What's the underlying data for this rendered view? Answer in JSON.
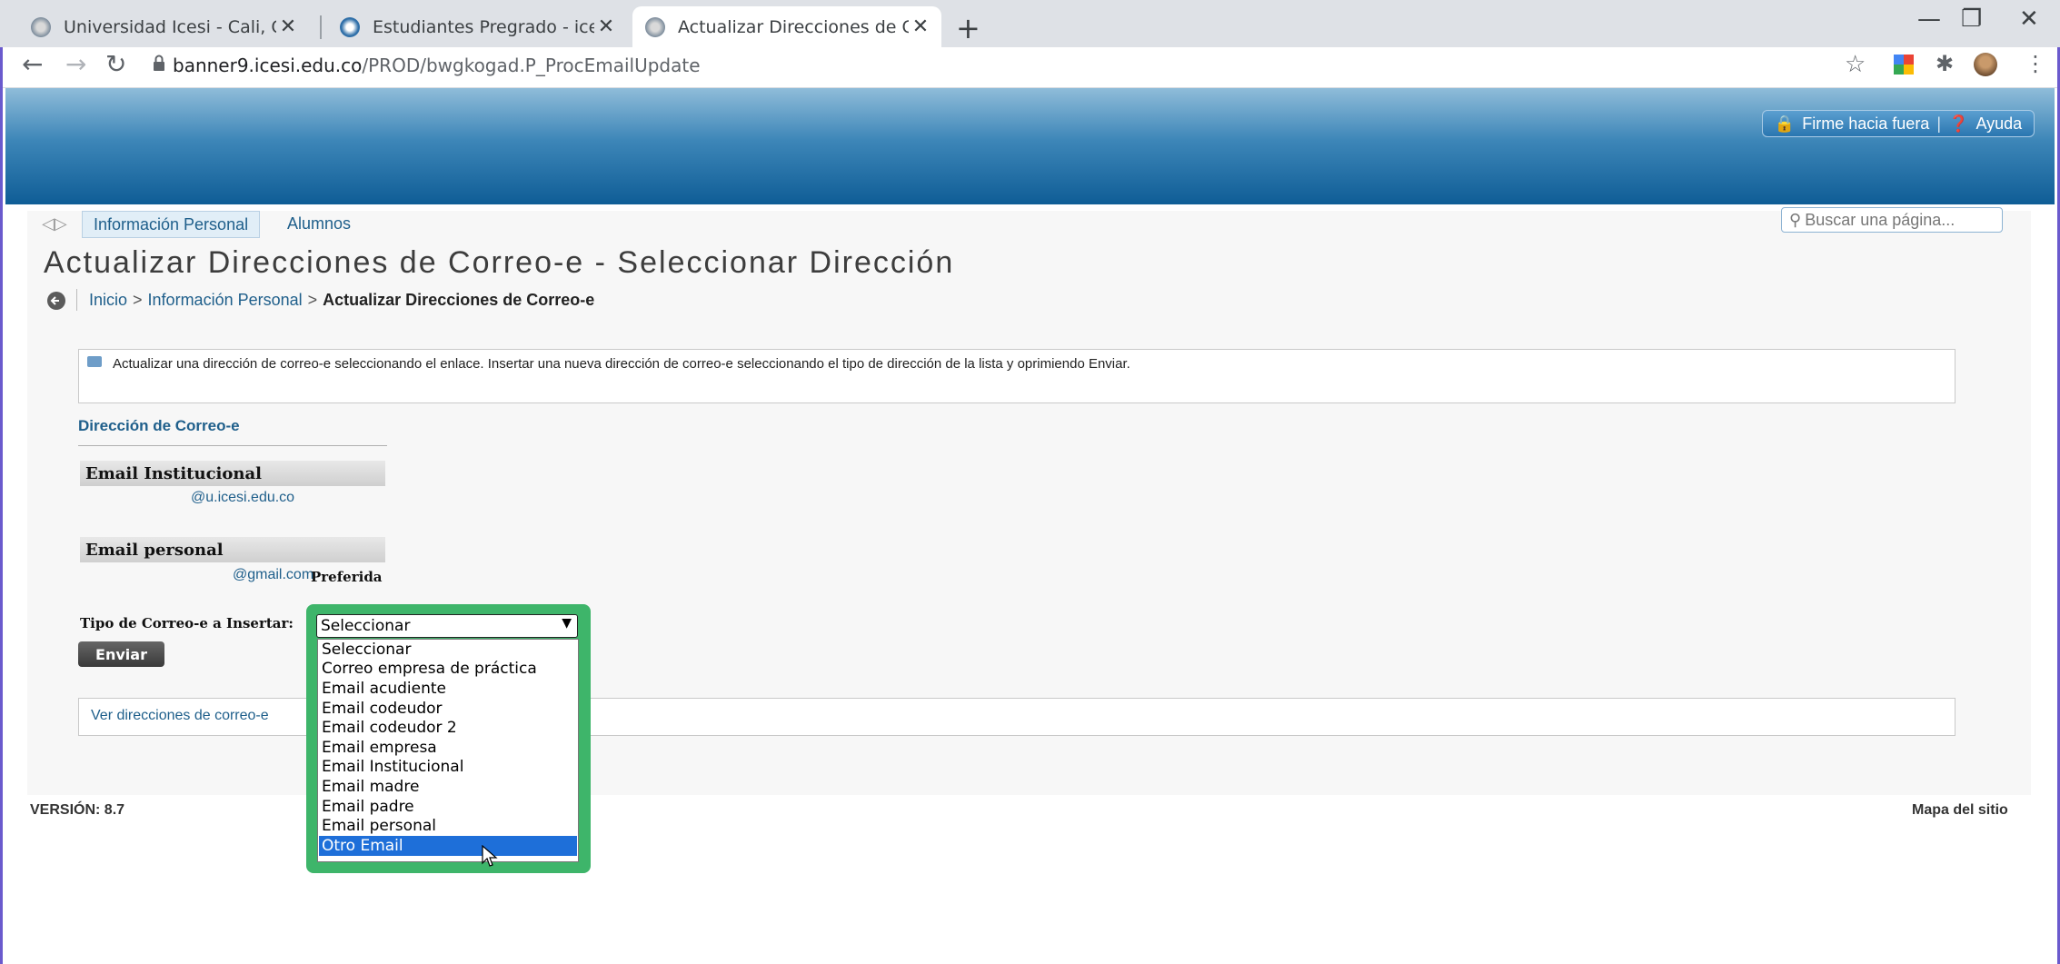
{
  "browser": {
    "tabs": [
      {
        "title": "Universidad Icesi - Cali, Colombia",
        "active": false
      },
      {
        "title": "Estudiantes Pregrado - icesi.edu.co",
        "active": false
      },
      {
        "title": "Actualizar Direcciones de Correo-e",
        "active": true
      }
    ],
    "new_tab": "+",
    "url_host": "banner9.icesi.edu.co",
    "url_path": "/PROD/bwgkogad.P_ProcEmailUpdate",
    "window_controls": {
      "minimize": "—",
      "restore": "❐",
      "close": "✕"
    }
  },
  "header": {
    "signout_label": "Firme hacia fuera",
    "help_label": "Ayuda"
  },
  "nav": {
    "tabs": [
      "Información Personal",
      "Alumnos"
    ],
    "search_placeholder": "Buscar una página..."
  },
  "page": {
    "title": "Actualizar Direcciones de Correo-e - Seleccionar Dirección",
    "breadcrumb": [
      "Inicio",
      "Información Personal",
      "Actualizar Direcciones de Correo-e"
    ],
    "info_text": "Actualizar una dirección de correo-e seleccionando el enlace. Insertar una nueva dirección de correo-e seleccionando el tipo de dirección de la lista y oprimiendo Enviar.",
    "section_title": "Dirección de Correo-e",
    "institutional_label": "Email Institucional",
    "institutional_email": "@u.icesi.edu.co",
    "personal_label": "Email personal",
    "personal_email": "@gmail.com",
    "preferred_label": "Preferida",
    "insert_type_label": "Tipo de Correo-e a Insertar:",
    "select_value": "Seleccionar",
    "select_options": [
      "Seleccionar",
      "Correo empresa de práctica",
      "Email acudiente",
      "Email codeudor",
      "Email codeudor 2",
      "Email empresa",
      "Email Institucional",
      "Email madre",
      "Email padre",
      "Email personal",
      "Otro Email"
    ],
    "highlighted_option": "Otro Email",
    "submit_label": "Enviar",
    "view_link": "Ver direcciones de correo-e",
    "version": "VERSIÓN: 8.7",
    "sitemap": "Mapa del sitio"
  },
  "colors": {
    "banner_dark": "#0f5d96",
    "link": "#1f5f8b",
    "highlight_frame": "#3eb56a",
    "option_selected": "#1e6fd9"
  }
}
